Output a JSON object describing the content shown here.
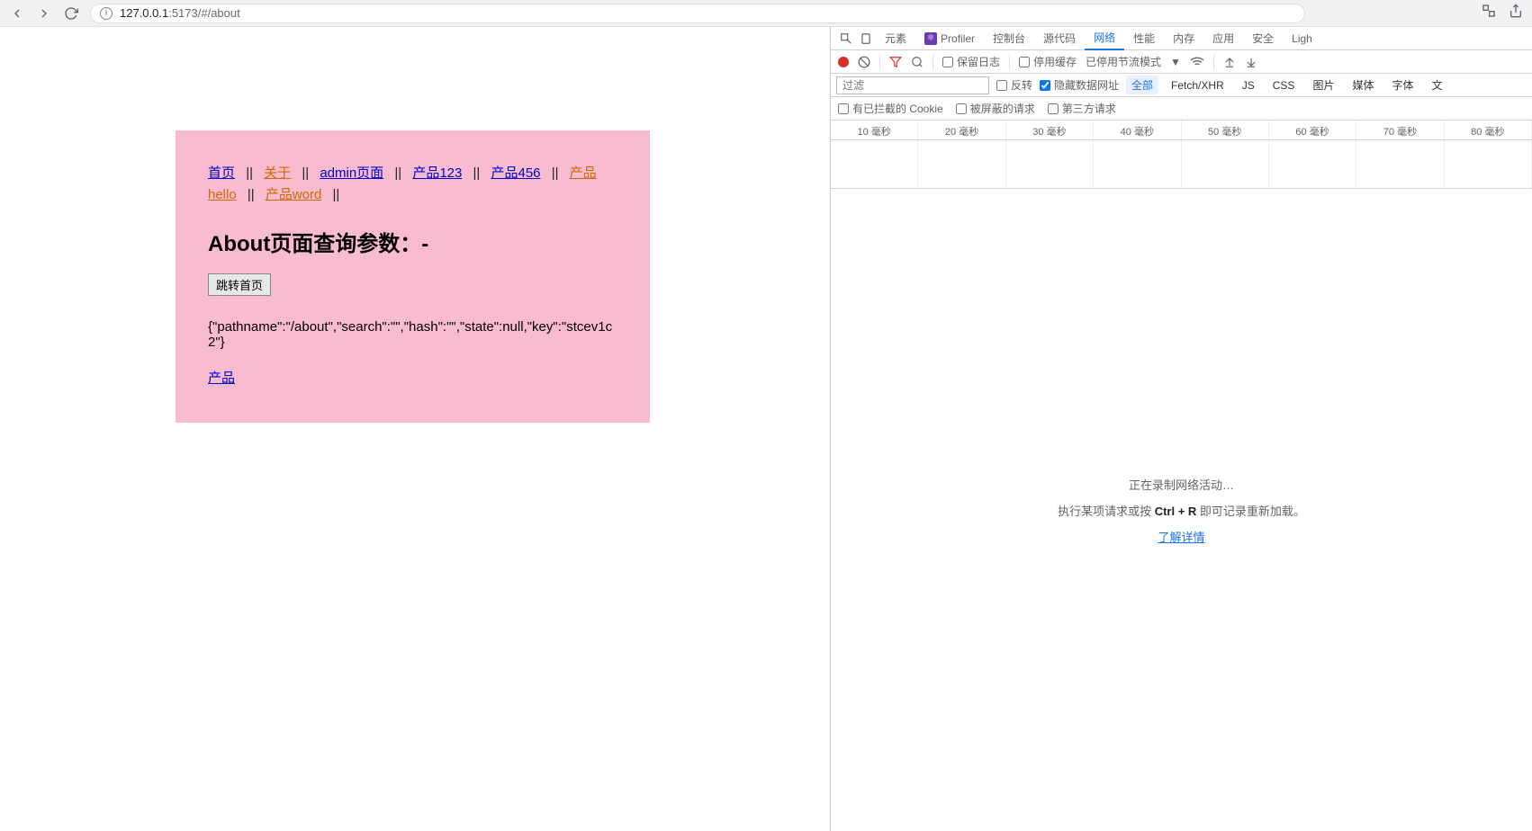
{
  "browser": {
    "url_host": "127.0.0.1",
    "url_port_path": ":5173/#/about"
  },
  "page": {
    "nav": {
      "home": "首页",
      "about": "关于",
      "admin": "admin页面",
      "prod123": "产品123",
      "prod456": "产品456",
      "prodHello": "产品hello",
      "prodWord": "产品word"
    },
    "separator": "||",
    "heading": "About页面查询参数：-",
    "jump_btn": "跳转首页",
    "json": "{\"pathname\":\"/about\",\"search\":\"\",\"hash\":\"\",\"state\":null,\"key\":\"stcev1c2\"}",
    "bottom_link": "产品"
  },
  "devtools": {
    "tabs": {
      "elements": "元素",
      "profiler": "Profiler",
      "console": "控制台",
      "sources": "源代码",
      "network": "网络",
      "performance": "性能",
      "memory": "内存",
      "application": "应用",
      "security": "安全",
      "lighthouse": "Ligh"
    },
    "toolbar": {
      "preserve_log": "保留日志",
      "disable_cache": "停用缓存",
      "throttling": "已停用节流模式"
    },
    "filter": {
      "placeholder": "过滤",
      "invert": "反转",
      "hide_data_urls": "隐藏数据网址",
      "all": "全部",
      "fetch_xhr": "Fetch/XHR",
      "js": "JS",
      "css": "CSS",
      "img": "图片",
      "media": "媒体",
      "font": "字体",
      "doc": "文"
    },
    "cookies_row": {
      "blocked_cookies": "有已拦截的 Cookie",
      "blocked_requests": "被屏蔽的请求",
      "third_party": "第三方请求"
    },
    "timeline": [
      "10 毫秒",
      "20 毫秒",
      "30 毫秒",
      "40 毫秒",
      "50 毫秒",
      "60 毫秒",
      "70 毫秒",
      "80 毫秒"
    ],
    "empty": {
      "recording": "正在录制网络活动…",
      "hint_pre": "执行某项请求或按 ",
      "hint_key": "Ctrl + R",
      "hint_post": " 即可记录重新加载。",
      "learn_more": "了解详情"
    }
  }
}
